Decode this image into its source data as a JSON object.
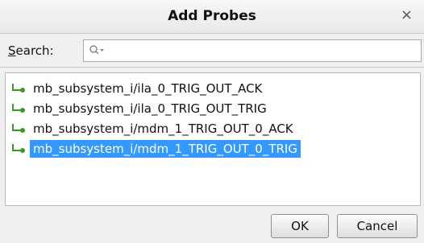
{
  "dialog": {
    "title": "Add Probes",
    "close_glyph": "×"
  },
  "search": {
    "label_accel": "S",
    "label_rest": "earch:",
    "value": "",
    "icon": "search-icon"
  },
  "probes": [
    {
      "label": "mb_subsystem_i/ila_0_TRIG_OUT_ACK",
      "selected": false
    },
    {
      "label": "mb_subsystem_i/ila_0_TRIG_OUT_TRIG",
      "selected": false
    },
    {
      "label": "mb_subsystem_i/mdm_1_TRIG_OUT_0_ACK",
      "selected": false
    },
    {
      "label": "mb_subsystem_i/mdm_1_TRIG_OUT_0_TRIG",
      "selected": true
    }
  ],
  "buttons": {
    "ok_label": "OK",
    "cancel_label": "Cancel"
  },
  "colors": {
    "selection": "#3399ff",
    "probe_icon": "#3a9a1f"
  }
}
